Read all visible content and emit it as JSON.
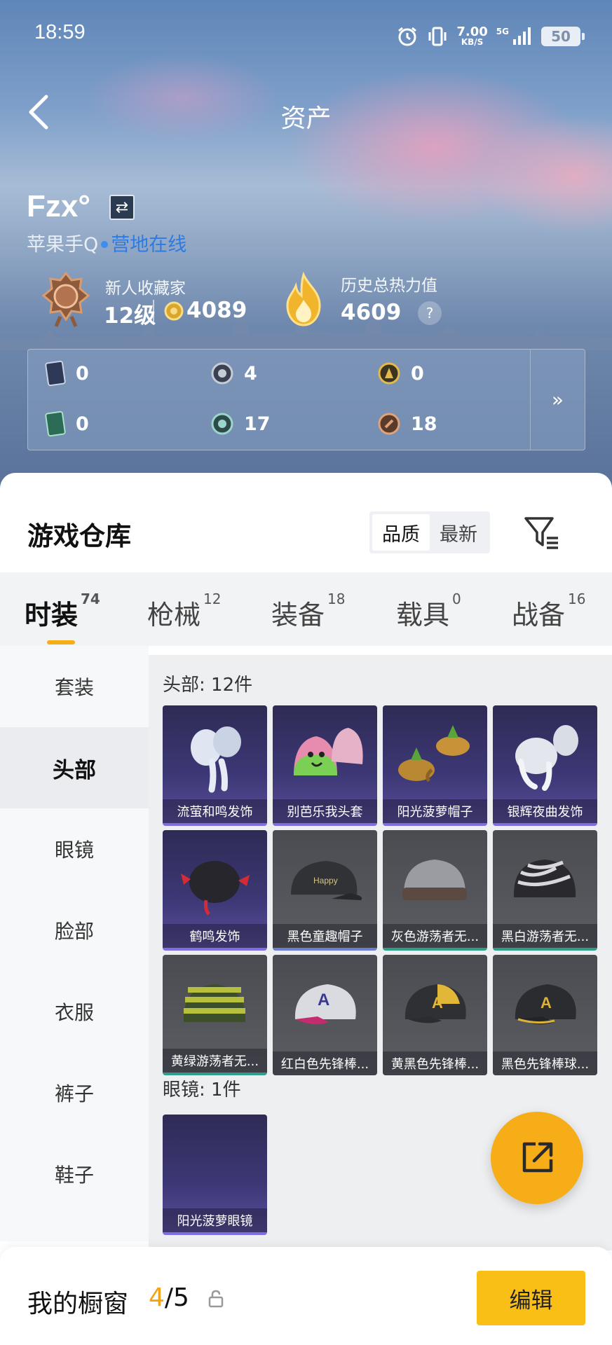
{
  "status_bar": {
    "time": "18:59",
    "net_speed": "7.00",
    "net_unit": "KB/S",
    "network": "5G",
    "battery": "50"
  },
  "nav": {
    "title": "资产"
  },
  "profile": {
    "name": "Fzx°",
    "platform": "苹果手Q",
    "online_status": "营地在线",
    "collector_title": "新人收藏家",
    "collector_level": "12级",
    "coins": "4089",
    "heat_title": "历史总热力值",
    "heat_value": "4609",
    "heat_help": "?"
  },
  "stats": [
    {
      "icon": "dark-card-icon",
      "value": "0"
    },
    {
      "icon": "silver-badge-icon",
      "value": "4"
    },
    {
      "icon": "gold-badge-icon",
      "value": "0"
    },
    {
      "icon": "green-card-icon",
      "value": "0"
    },
    {
      "icon": "teal-badge-icon",
      "value": "17"
    },
    {
      "icon": "bronze-badge-icon",
      "value": "18"
    }
  ],
  "stats_more": "»",
  "warehouse": {
    "title": "游戏仓库",
    "sort_options": [
      "品质",
      "最新"
    ],
    "sort_active": "品质"
  },
  "categories": [
    {
      "label": "时装",
      "count": "74"
    },
    {
      "label": "枪械",
      "count": "12"
    },
    {
      "label": "装备",
      "count": "18"
    },
    {
      "label": "载具",
      "count": "0"
    },
    {
      "label": "战备",
      "count": "16"
    }
  ],
  "sub_categories": [
    "套装",
    "头部",
    "眼镜",
    "脸部",
    "衣服",
    "裤子",
    "鞋子"
  ],
  "sections": [
    {
      "title": "头部: 12件",
      "items": [
        {
          "name": "流萤和鸣发饰",
          "rarity": "purple",
          "icon": "silver-braids-hair-icon"
        },
        {
          "name": "别芭乐我头套",
          "rarity": "purple",
          "icon": "guava-headgear-icon"
        },
        {
          "name": "阳光菠萝帽子",
          "rarity": "purple",
          "icon": "pineapple-hat-icon"
        },
        {
          "name": "银辉夜曲发饰",
          "rarity": "purple",
          "icon": "silver-hair-icon"
        },
        {
          "name": "鹤鸣发饰",
          "rarity": "purple",
          "icon": "black-hair-bow-icon"
        },
        {
          "name": "黑色童趣帽子",
          "rarity": "gray-blue",
          "icon": "black-cap-icon"
        },
        {
          "name": "灰色游荡者无...",
          "rarity": "gray-green",
          "icon": "gray-beanie-icon"
        },
        {
          "name": "黑白游荡者无...",
          "rarity": "gray-green",
          "icon": "zebra-beanie-icon"
        },
        {
          "name": "黄绿游荡者无...",
          "rarity": "gray-green",
          "icon": "striped-beanie-icon"
        },
        {
          "name": "红白色先锋棒...",
          "rarity": "gray",
          "icon": "red-white-cap-icon"
        },
        {
          "name": "黄黑色先锋棒...",
          "rarity": "gray",
          "icon": "yellow-black-cap-icon"
        },
        {
          "name": "黑色先锋棒球...",
          "rarity": "gray",
          "icon": "black-gold-cap-icon"
        }
      ]
    },
    {
      "title": "眼镜: 1件",
      "items": [
        {
          "name": "阳光菠萝眼镜",
          "rarity": "purple",
          "icon": "pineapple-glasses-icon"
        }
      ]
    }
  ],
  "showcase": {
    "label": "我的橱窗",
    "current": "4",
    "total": "/5",
    "edit_label": "编辑"
  }
}
